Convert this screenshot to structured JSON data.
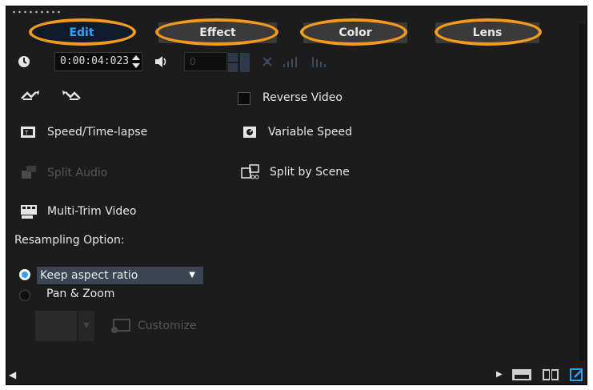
{
  "tabs": [
    {
      "label": "Edit",
      "active": true
    },
    {
      "label": "Effect",
      "active": false
    },
    {
      "label": "Color",
      "active": false
    },
    {
      "label": "Lens",
      "active": false
    }
  ],
  "toolbar": {
    "timecode": "0:00:04:023",
    "volume_value": "0"
  },
  "options": {
    "reverse_video": "Reverse Video",
    "speed_timelapse": "Speed/Time-lapse",
    "variable_speed": "Variable Speed",
    "split_audio": "Split Audio",
    "split_by_scene": "Split by Scene",
    "multi_trim": "Multi-Trim Video"
  },
  "resampling": {
    "heading": "Resampling Option:",
    "keep_aspect_selected": "Keep aspect ratio",
    "pan_zoom": "Pan & Zoom",
    "customize": "Customize"
  },
  "colors": {
    "accent": "#2aa5ff",
    "highlight_ring": "#f39a1c",
    "panel_bg": "#1c1c1c"
  }
}
